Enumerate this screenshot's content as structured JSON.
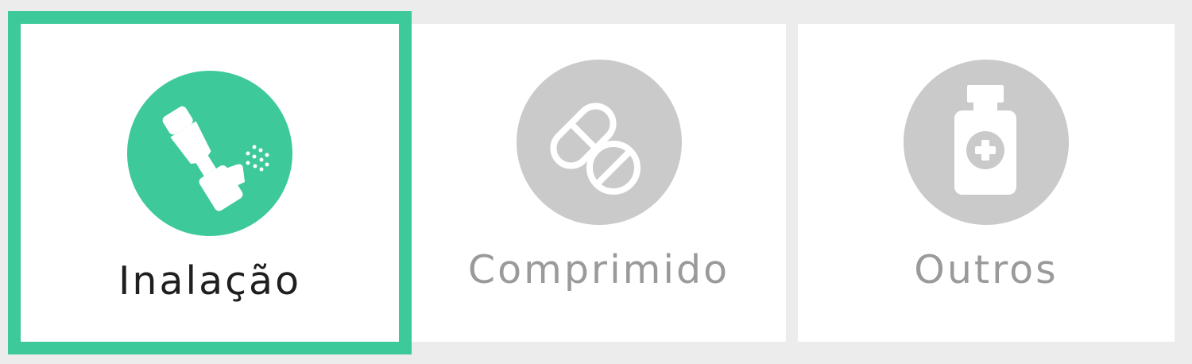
{
  "options": [
    {
      "label": "Inalação",
      "icon": "inhaler-icon",
      "selected": true
    },
    {
      "label": "Comprimido",
      "icon": "pills-icon",
      "selected": false
    },
    {
      "label": "Outros",
      "icon": "medicine-bottle-icon",
      "selected": false
    }
  ],
  "colors": {
    "accent": "#3ec99b",
    "inactive_circle": "#cacaca",
    "inactive_text": "#9a9a9a",
    "active_text": "#1f1f1f",
    "background": "#ececec",
    "card": "#ffffff"
  }
}
